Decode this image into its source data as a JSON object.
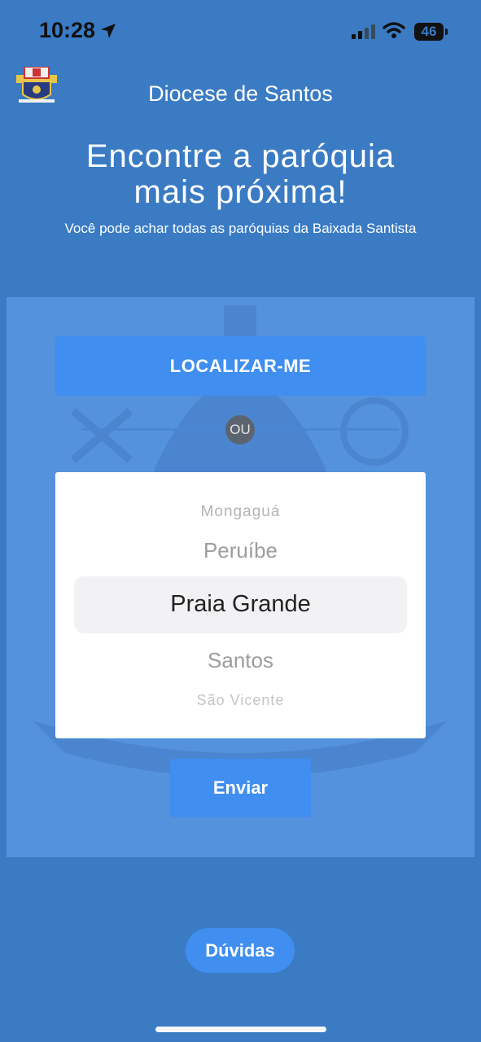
{
  "status_bar": {
    "time": "10:28",
    "battery": "46"
  },
  "header": {
    "title": "Diocese de Santos",
    "logo_icon": "diocese-coat-of-arms-icon"
  },
  "hero": {
    "headline_line1": "Encontre a paróquia",
    "headline_line2": "mais próxima!",
    "subheadline": "Você pode achar todas as paróquias da Baixada Santista"
  },
  "form": {
    "locate_label": "LOCALIZAR-ME",
    "or_label": "OU",
    "picker": {
      "items_above": [
        "Mongaguá",
        "Peruíbe"
      ],
      "selected": "Praia Grande",
      "items_below": [
        "Santos",
        "São Vicente"
      ]
    },
    "submit_label": "Enviar"
  },
  "help_label": "Dúvidas",
  "colors": {
    "background": "#3a7bc4",
    "panel": "#5592dd",
    "button": "#3f8ef0"
  }
}
